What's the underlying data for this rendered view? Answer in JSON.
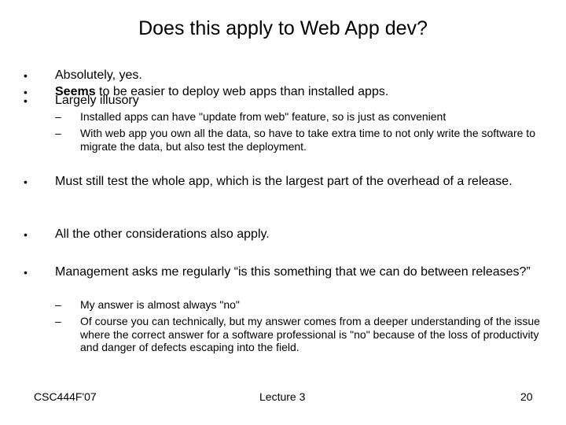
{
  "slide": {
    "title": "Does this apply to Web App dev?",
    "bullets": [
      {
        "bold_prefix": "",
        "text": "Absolutely, yes."
      },
      {
        "bold_prefix": "Seems",
        "text": " to be easier to deploy web apps than installed apps."
      },
      {
        "bold_prefix": "",
        "text": "Largely illusory"
      },
      {
        "bold_prefix": "",
        "text": "Must still test the whole app, which is the largest part of the overhead of a release."
      },
      {
        "bold_prefix": "",
        "text": "All the other considerations also apply."
      },
      {
        "bold_prefix": "",
        "text": "Management asks me regularly “is this something that we can do between releases?”"
      }
    ],
    "sub_bullets_illusory": [
      "Installed apps can have \"update from web\" feature, so is just as convenient",
      "With web app you own all the data, so have to take extra time to not only write the software to migrate the data, but also test the deployment."
    ],
    "sub_bullets_management": [
      "My answer is almost always \"no\"",
      "Of course you can technically, but my answer comes from a deeper understanding of the issue where the correct answer for a software professional is \"no\" because of the loss of productivity and danger of defects escaping into the field."
    ],
    "bullet_glyph": "•",
    "dash_glyph": "–"
  },
  "footer": {
    "course": "CSC444F'07",
    "lecture": "Lecture 3",
    "page_number": "20"
  }
}
